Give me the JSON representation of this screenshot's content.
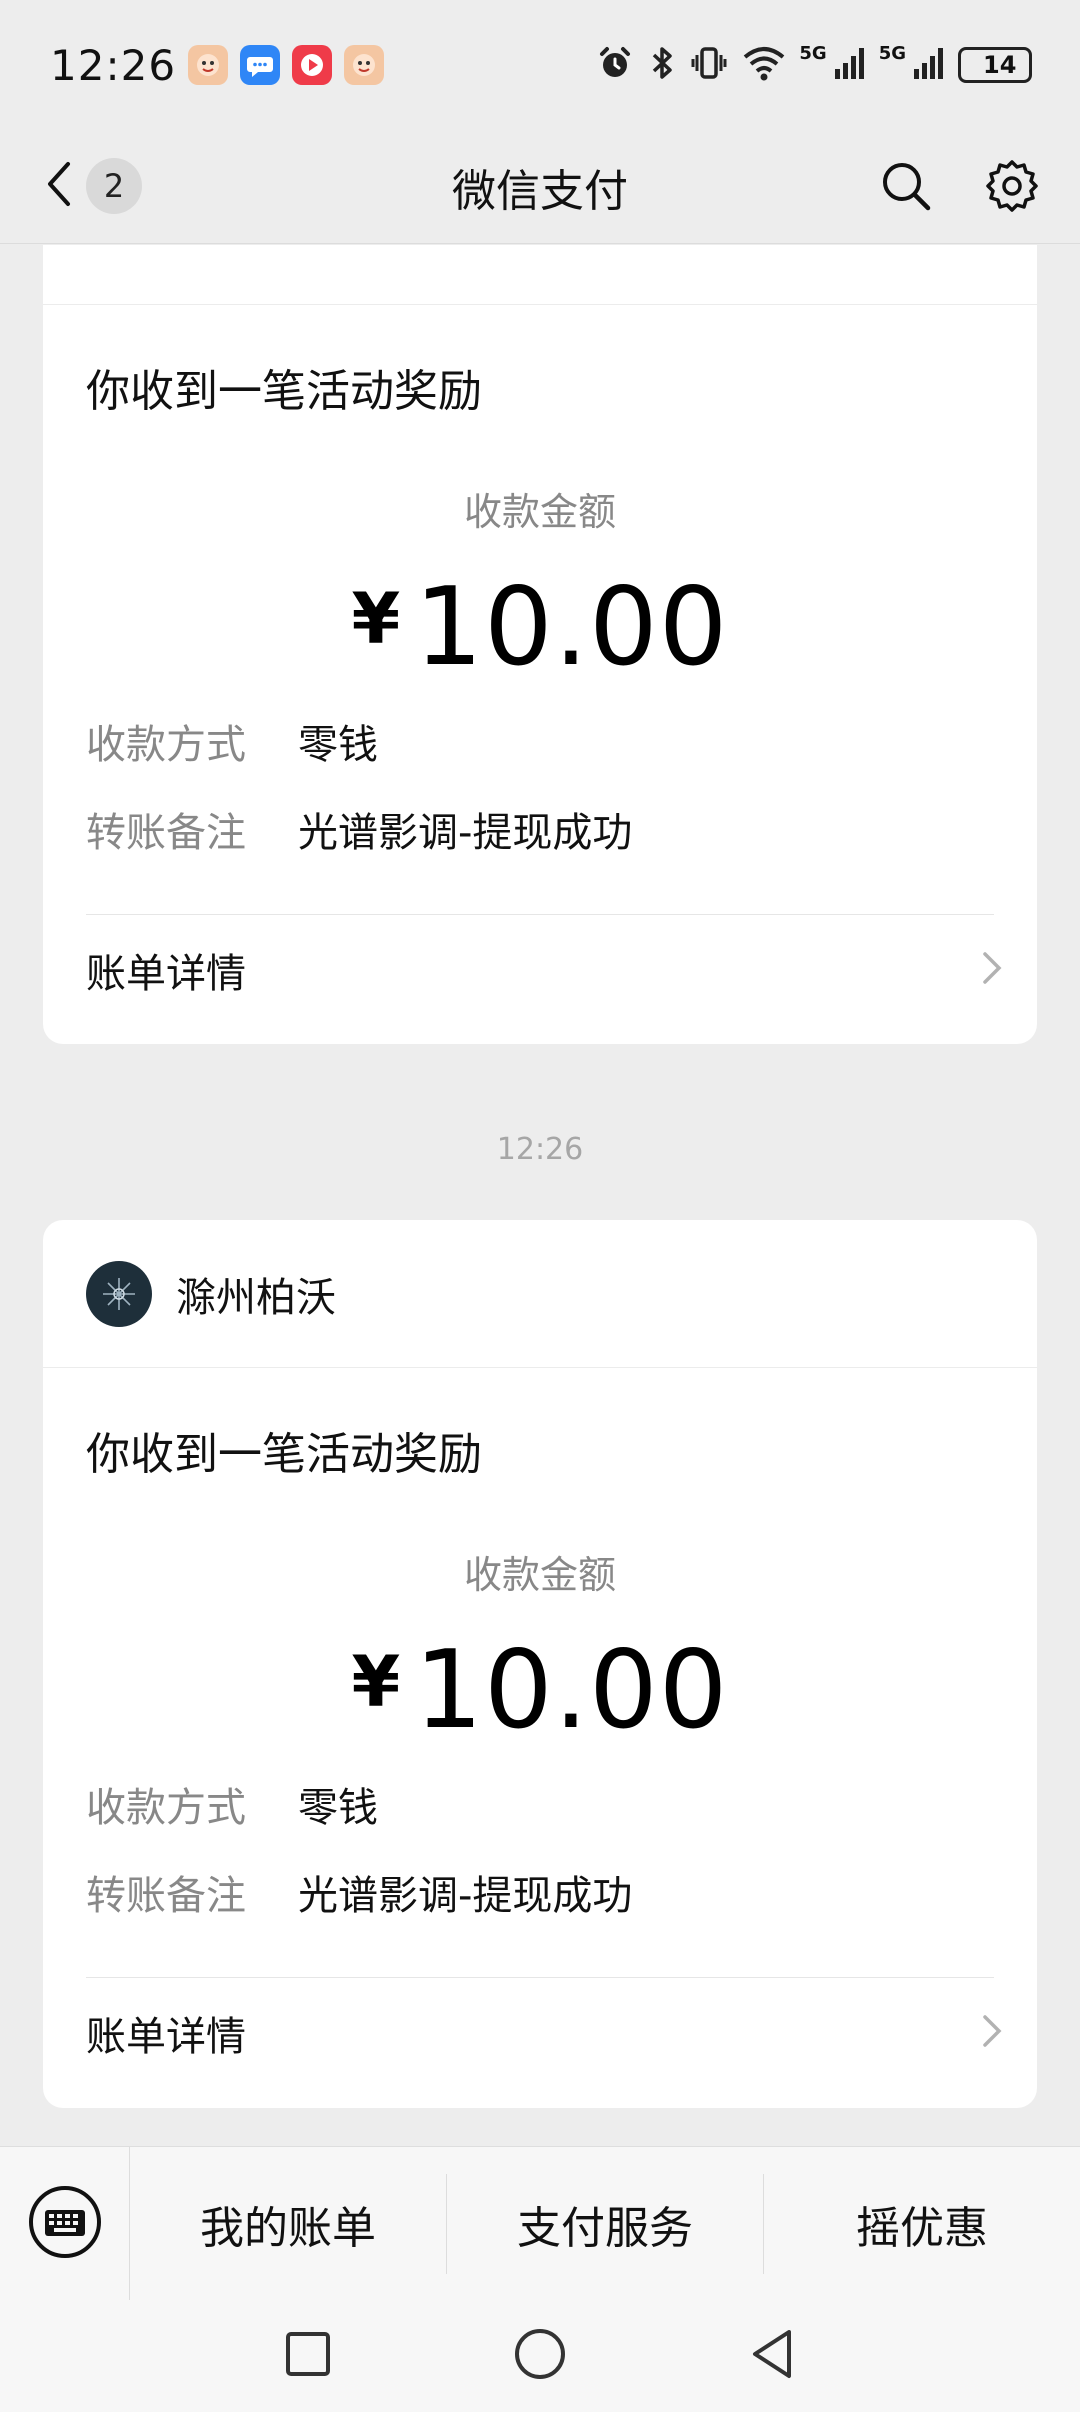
{
  "status_bar": {
    "time": "12:26",
    "signal_1": "5G",
    "signal_2": "5G",
    "battery": "14"
  },
  "title_bar": {
    "back_count": "2",
    "title": "微信支付"
  },
  "card_partial": {
    "title": "你收到一笔活动奖励",
    "amount_label": "收款金额",
    "currency": "¥",
    "amount": "10.00",
    "method_key": "收款方式",
    "method_value": "零钱",
    "note_key": "转账备注",
    "note_value": "光谱影调-提现成功",
    "detail_label": "账单详情"
  },
  "timestamp": "12:26",
  "card_full": {
    "merchant": "滁州柏沃",
    "title": "你收到一笔活动奖励",
    "amount_label": "收款金额",
    "currency": "¥",
    "amount": "10.00",
    "method_key": "收款方式",
    "method_value": "零钱",
    "note_key": "转账备注",
    "note_value": "光谱影调-提现成功",
    "detail_label": "账单详情"
  },
  "bottom_menu": {
    "items": [
      "我的账单",
      "支付服务",
      "摇优惠"
    ]
  },
  "colors": {
    "background": "#ededed",
    "card": "#ffffff",
    "battery_fill": "#f3a12e"
  }
}
